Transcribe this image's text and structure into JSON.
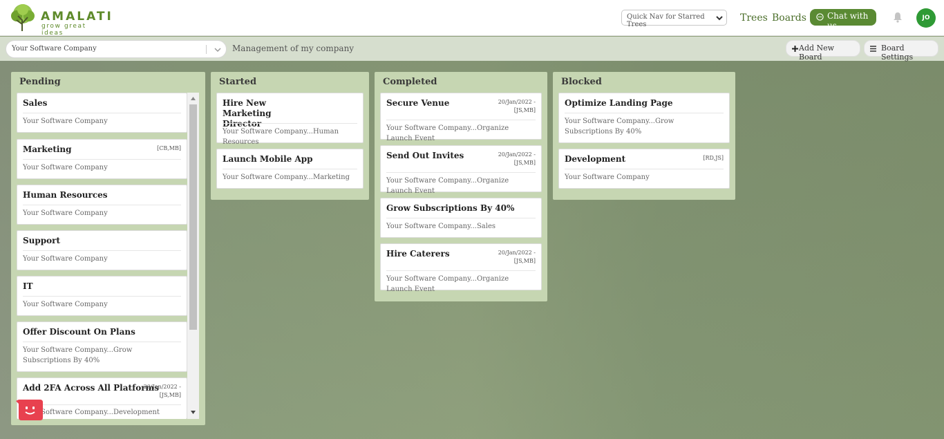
{
  "app": {
    "logo": {
      "brand": "AMALATI",
      "tagline": "grow great ideas"
    },
    "quick_nav": "Quick Nav for Starred Trees",
    "nav": {
      "trees": "Trees",
      "boards": "Boards"
    },
    "chat_button": "Chat with us",
    "avatar_initials": "JO",
    "colors": {
      "brand": "#5e8a2a",
      "chat": "#5a8a33",
      "avatar": "#2f9a35",
      "column": "#c6d6b2"
    }
  },
  "toolbar": {
    "company": "Your Software Company",
    "board_description": "Management of my company",
    "add_board": "Add New Board",
    "board_settings": "Board Settings"
  },
  "columns": [
    {
      "title": "Pending",
      "cards": [
        {
          "title": "Sales",
          "meta": "",
          "sub": "Your Software Company"
        },
        {
          "title": "Marketing",
          "meta": "[CB,MB]",
          "sub": "Your Software Company"
        },
        {
          "title": "Human Resources",
          "meta": "",
          "sub": "Your Software Company"
        },
        {
          "title": "Support",
          "meta": "",
          "sub": "Your Software Company"
        },
        {
          "title": "IT",
          "meta": "",
          "sub": "Your Software Company"
        },
        {
          "title": "Offer Discount On Plans",
          "meta": "",
          "sub": "Your Software Company...Grow Subscriptions By 40%"
        },
        {
          "title": "Add 2FA Across All Platforms",
          "meta": "20/Jan/2022 - [JS,MB]",
          "sub": "Your Software Company...Development"
        }
      ]
    },
    {
      "title": "Started",
      "cards": [
        {
          "title": "Hire New Marketing Director",
          "meta": "",
          "sub": "Your Software Company...Human Resources"
        },
        {
          "title": "Launch Mobile App",
          "meta": "",
          "sub": "Your Software Company...Marketing"
        }
      ]
    },
    {
      "title": "Completed",
      "cards": [
        {
          "title": "Secure Venue",
          "meta": "20/Jan/2022 - [JS,MB]",
          "sub": "Your Software Company...Organize Launch Event"
        },
        {
          "title": "Send Out Invites",
          "meta": "20/Jan/2022 - [JS,MB]",
          "sub": "Your Software Company...Organize Launch Event"
        },
        {
          "title": "Grow Subscriptions By 40%",
          "meta": "",
          "sub": "Your Software Company...Sales"
        },
        {
          "title": "Hire Caterers",
          "meta": "20/Jan/2022 - [JS,MB]",
          "sub": "Your Software Company...Organize Launch Event"
        }
      ]
    },
    {
      "title": "Blocked",
      "cards": [
        {
          "title": "Optimize Landing Page",
          "meta": "",
          "sub": "Your Software Company...Grow Subscriptions By 40%"
        },
        {
          "title": "Development",
          "meta": "[RD,JS]",
          "sub": "Your Software Company"
        }
      ]
    }
  ]
}
